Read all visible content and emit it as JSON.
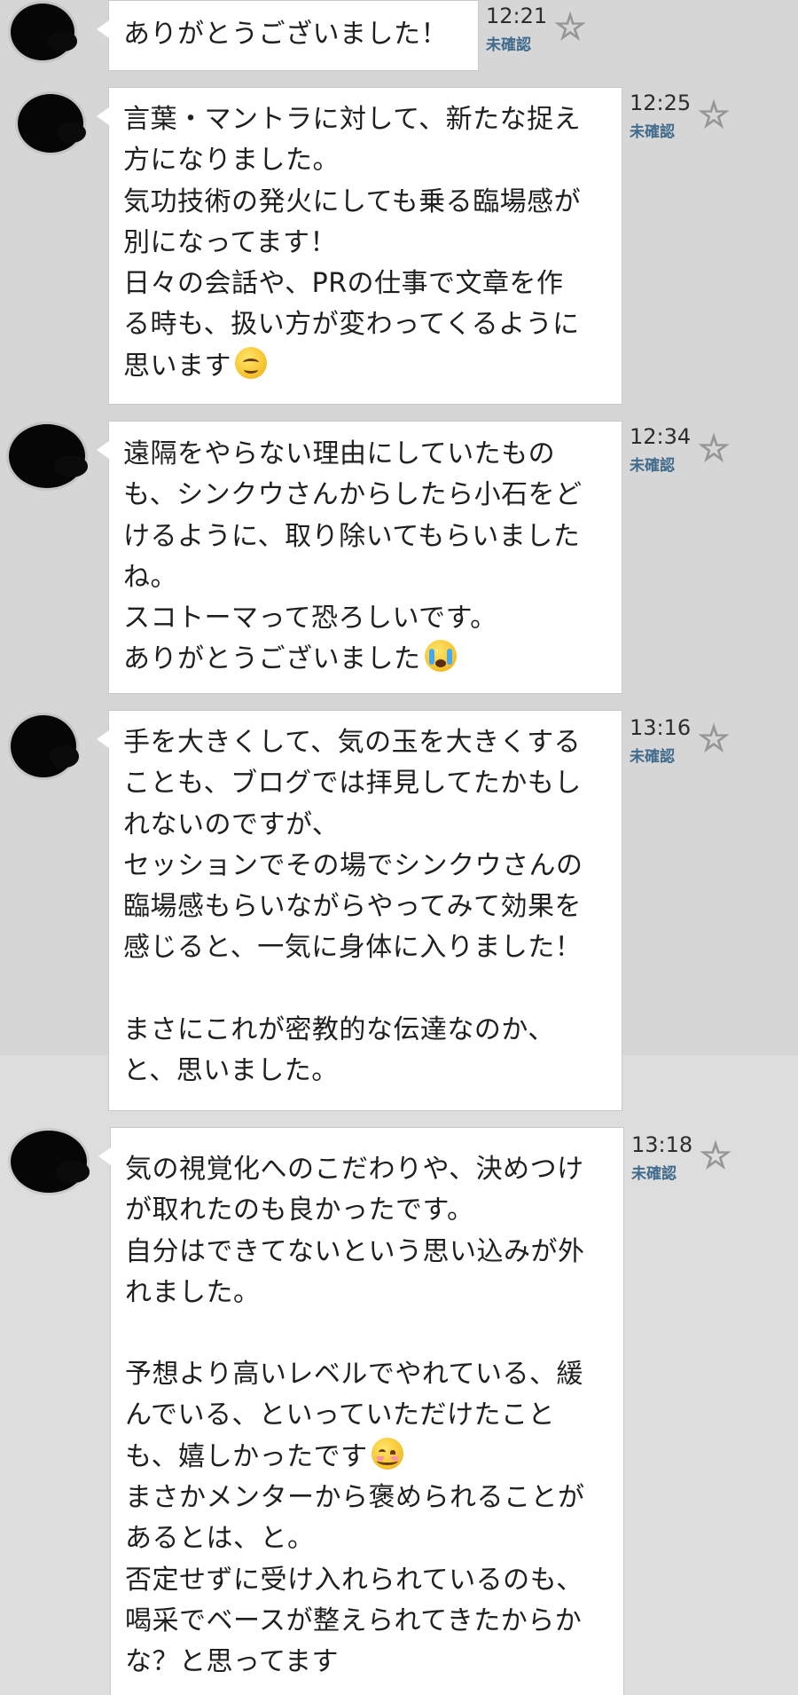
{
  "messages": [
    {
      "time": "12:21",
      "status": "未確認",
      "lines": [
        "ありがとうございました！"
      ],
      "emoji": null
    },
    {
      "time": "12:25",
      "status": "未確認",
      "lines": [
        "言葉・マントラに対して、新たな捉え",
        "方になりました。",
        "気功技術の発火にしても乗る臨場感が",
        "別になってます！",
        "日々の会話や、PRの仕事で文章を作",
        "る時も、扱い方が変わってくるように",
        "思います"
      ],
      "emoji": "smiling-face"
    },
    {
      "time": "12:34",
      "status": "未確認",
      "lines": [
        "遠隔をやらない理由にしていたもの",
        "も、シンクウさんからしたら小石をど",
        "けるように、取り除いてもらいました",
        "ね。",
        "スコトーマって恐ろしいです。",
        "ありがとうございました"
      ],
      "emoji": "crying-face"
    },
    {
      "time": "13:16",
      "status": "未確認",
      "lines": [
        "手を大きくして、気の玉を大きくする",
        "ことも、ブログでは拝見してたかもし",
        "れないのですが、",
        "セッションでその場でシンクウさんの",
        "臨場感もらいながらやってみて効果を",
        "感じると、一気に身体に入りました！",
        "",
        "まさにこれが密教的な伝達なのか、",
        "と、思いました。"
      ],
      "emoji": null
    },
    {
      "time": "13:18",
      "status": "未確認",
      "lines": [
        "気の視覚化へのこだわりや、決めつけ",
        "が取れたのも良かったです。",
        "自分はできてないという思い込みが外",
        "れました。",
        "",
        "予想より高いレベルでやれている、緩",
        "んでいる、といっていただけたこと",
        "も、嬉しかったです",
        "まさかメンターから褒められることが",
        "あるとは、と。",
        "否定せずに受け入れられているのも、",
        "喝采でベースが整えられてきたからか",
        "な？と思ってます"
      ],
      "emoji": "blushing-face"
    }
  ],
  "icons": {
    "avatar": "avatar-redacted",
    "favorite": "star-icon"
  },
  "colors": {
    "background": "#d6d6d6",
    "bubble": "#ffffff",
    "status": "#416b8c",
    "star": "#969696"
  }
}
